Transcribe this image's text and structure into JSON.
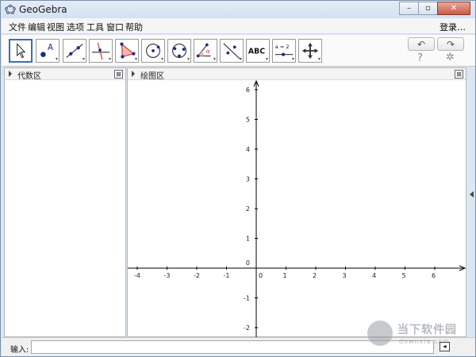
{
  "window": {
    "title": "GeoGebra"
  },
  "window_controls": {
    "minimize": "–",
    "maximize": "▫",
    "close": "✕"
  },
  "menu": {
    "items": [
      "文件",
      "编辑",
      "视图",
      "选项",
      "工具",
      "窗口",
      "帮助"
    ],
    "login": "登录…"
  },
  "toolbar": {
    "undo": "↶",
    "redo": "↷",
    "help": "?",
    "settings": "✲",
    "tools": [
      {
        "name": "move-tool-icon",
        "text": ""
      },
      {
        "name": "point-tool-icon",
        "text": "A"
      },
      {
        "name": "line-tool-icon",
        "text": ""
      },
      {
        "name": "perpendicular-tool-icon",
        "text": ""
      },
      {
        "name": "polygon-tool-icon",
        "text": ""
      },
      {
        "name": "circle-tool-icon",
        "text": ""
      },
      {
        "name": "conic-tool-icon",
        "text": ""
      },
      {
        "name": "angle-tool-icon",
        "text": "α"
      },
      {
        "name": "reflect-tool-icon",
        "text": ""
      },
      {
        "name": "text-tool-icon",
        "text": "ABC"
      },
      {
        "name": "slider-tool-icon",
        "text": "a = 2"
      },
      {
        "name": "move-view-tool-icon",
        "text": ""
      }
    ]
  },
  "algebra_panel": {
    "title": "代数区",
    "close": "⊠"
  },
  "graphics_panel": {
    "title": "绘图区",
    "close": "⊠",
    "x_ticks": [
      "-4",
      "-3",
      "-2",
      "-1",
      "0",
      "1",
      "2",
      "3",
      "4",
      "5",
      "6"
    ],
    "y_ticks_pos": [
      "6",
      "5",
      "4",
      "3",
      "2",
      "1"
    ],
    "y_ticks_neg": [
      "-1",
      "-2"
    ],
    "origin": "0",
    "colors": {
      "axis": "#000000",
      "background": "#ffffff"
    }
  },
  "input_bar": {
    "label": "输入:",
    "value": "",
    "placeholder": "",
    "help": "◂"
  },
  "watermark": {
    "title": "当下软件园",
    "subtitle": "downxia.com"
  }
}
